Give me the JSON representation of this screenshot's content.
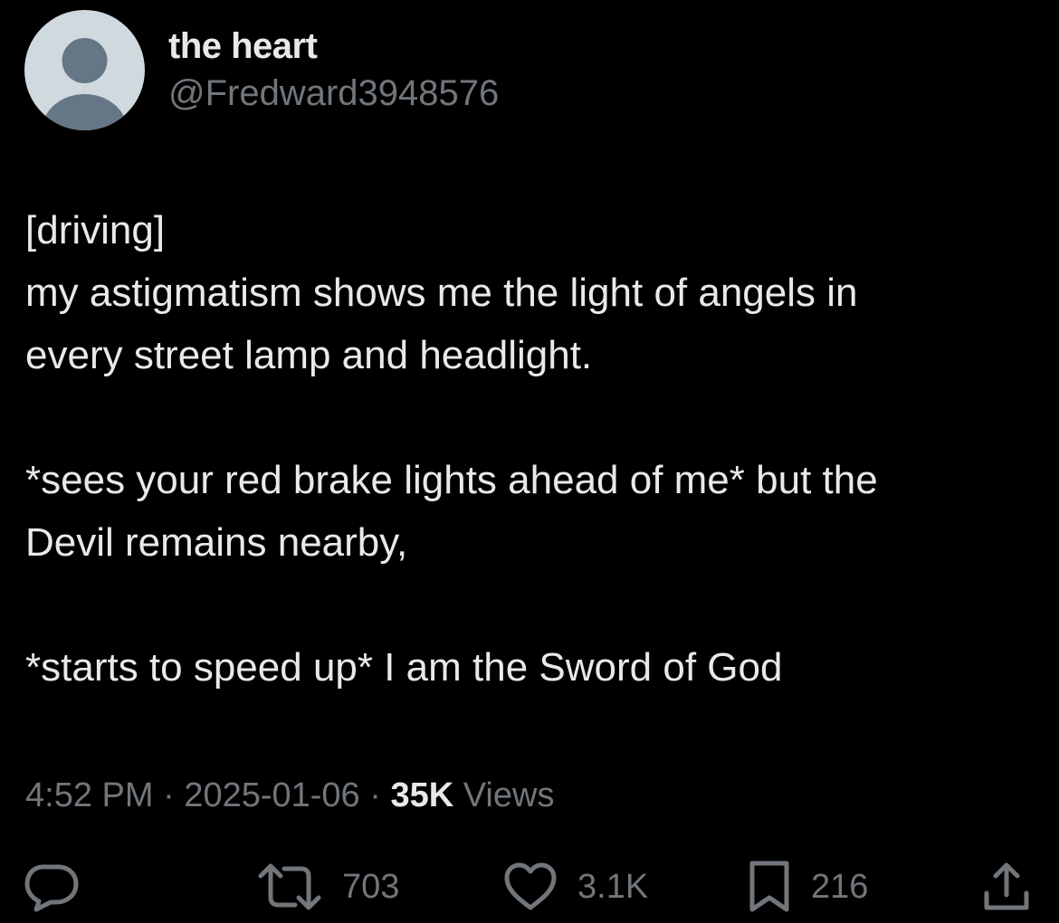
{
  "colors": {
    "background": "#000000",
    "primary_text": "#e7e9ea",
    "secondary_text": "#71767b",
    "avatar_bg": "#cfd9de",
    "avatar_fg": "#657786"
  },
  "author": {
    "display_name": "the heart",
    "handle": "@Fredward3948576",
    "avatar_icon": "default-avatar-icon"
  },
  "tweet": {
    "lines": [
      "[driving]",
      "my astigmatism shows me the light of angels in",
      "every street lamp and headlight.",
      "",
      "*sees your red brake lights ahead of me* but the",
      "Devil remains nearby,",
      "",
      "*starts to speed up* I am the Sword of God"
    ]
  },
  "meta": {
    "time": "4:52 PM",
    "separator": " · ",
    "date": "2025-01-06",
    "views_count": "35K",
    "views_label": " Views"
  },
  "actions": {
    "reply": {
      "icon": "reply-icon",
      "count": ""
    },
    "retweet": {
      "icon": "retweet-icon",
      "count": "703"
    },
    "like": {
      "icon": "heart-icon",
      "count": "3.1K"
    },
    "bookmark": {
      "icon": "bookmark-icon",
      "count": "216"
    },
    "share": {
      "icon": "share-icon",
      "count": ""
    }
  }
}
